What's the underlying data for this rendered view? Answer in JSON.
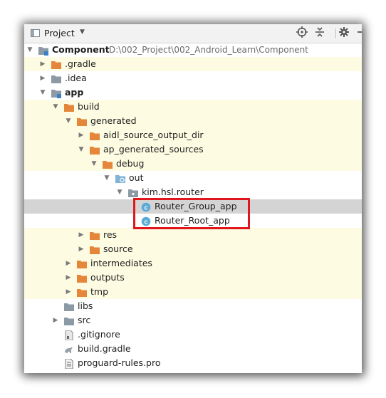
{
  "header": {
    "title": "Project",
    "caret_icon": "dropdown-caret-icon",
    "buttons": [
      "locate-icon",
      "collapse-all-icon",
      "settings-gear-icon"
    ]
  },
  "colors": {
    "folder_orange": "#e5873a",
    "folder_gray": "#8c9aa5",
    "highlight_row": "#fdfbe1",
    "selected_row": "#d4d4d4",
    "class_icon": "#5aa9d6",
    "red_box": "#e0181e"
  },
  "tree": [
    {
      "label": "Component",
      "bold": true,
      "path": "D:\\002_Project\\002_Android_Learn\\Component",
      "icon": "module-folder-icon",
      "arrow": "expanded"
    },
    {
      "label": ".gradle",
      "icon": "orange-folder-icon",
      "arrow": "collapsed"
    },
    {
      "label": ".idea",
      "icon": "gray-folder-icon",
      "arrow": "collapsed"
    },
    {
      "label": "app",
      "bold": true,
      "icon": "module-folder-icon",
      "arrow": "expanded"
    },
    {
      "label": "build",
      "icon": "orange-folder-icon",
      "arrow": "expanded"
    },
    {
      "label": "generated",
      "icon": "orange-folder-icon",
      "arrow": "expanded"
    },
    {
      "label": "aidl_source_output_dir",
      "icon": "orange-folder-icon",
      "arrow": "collapsed"
    },
    {
      "label": "ap_generated_sources",
      "icon": "orange-folder-icon",
      "arrow": "expanded"
    },
    {
      "label": "debug",
      "icon": "orange-folder-icon",
      "arrow": "expanded"
    },
    {
      "label": "out",
      "icon": "generated-source-folder-icon",
      "arrow": "expanded"
    },
    {
      "label": "kim.hsl.router",
      "icon": "package-icon",
      "arrow": "expanded"
    },
    {
      "label": "Router_Group_app",
      "icon": "class-icon",
      "arrow": "none"
    },
    {
      "label": "Router_Root_app",
      "icon": "class-icon",
      "arrow": "none"
    },
    {
      "label": "res",
      "icon": "orange-folder-icon",
      "arrow": "collapsed"
    },
    {
      "label": "source",
      "icon": "orange-folder-icon",
      "arrow": "collapsed"
    },
    {
      "label": "intermediates",
      "icon": "orange-folder-icon",
      "arrow": "collapsed"
    },
    {
      "label": "outputs",
      "icon": "orange-folder-icon",
      "arrow": "collapsed"
    },
    {
      "label": "tmp",
      "icon": "orange-folder-icon",
      "arrow": "collapsed"
    },
    {
      "label": "libs",
      "icon": "gray-folder-icon",
      "arrow": "none"
    },
    {
      "label": "src",
      "icon": "gray-folder-icon",
      "arrow": "collapsed"
    },
    {
      "label": ".gitignore",
      "icon": "gitignore-file-icon",
      "arrow": "none"
    },
    {
      "label": "build.gradle",
      "icon": "gradle-file-icon",
      "arrow": "none"
    },
    {
      "label": "proguard-rules.pro",
      "icon": "text-file-icon",
      "arrow": "none"
    }
  ]
}
